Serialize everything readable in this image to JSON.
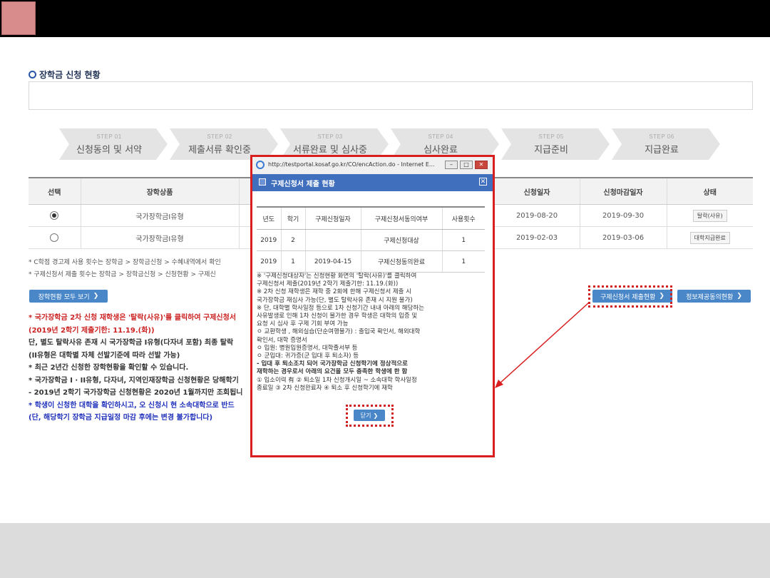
{
  "section_title": "장학금 신청 현황",
  "steps": [
    {
      "num": "STEP 01",
      "label": "신청동의 및 서약"
    },
    {
      "num": "STEP 02",
      "label": "제출서류 확인중"
    },
    {
      "num": "STEP 03",
      "label": "서류완료 및 심사중"
    },
    {
      "num": "STEP 04",
      "label": "심사완료"
    },
    {
      "num": "STEP 05",
      "label": "지급준비"
    },
    {
      "num": "STEP 06",
      "label": "지급완료"
    }
  ],
  "table": {
    "headers": [
      "선택",
      "장학상품",
      "신청일자",
      "신청마감일자",
      "상태"
    ],
    "rows": [
      {
        "product": "국가장학금I유형",
        "applied": "2019-08-20",
        "deadline": "2019-09-30",
        "status": "탈락(사유)",
        "selected": true
      },
      {
        "product": "국가장학금I유형",
        "applied": "2019-02-03",
        "deadline": "2019-03-06",
        "status": "대학지급완료",
        "selected": false
      }
    ]
  },
  "notes": [
    "* C학점 경고제 사용 횟수는 장학금 > 장학금신청 > 수혜내역에서 확인",
    "* 구제신청서 제출 횟수는 장학금 > 장학금신청 > 신청현황 > 구제신"
  ],
  "buttons": {
    "view_all": "장학현황 모두 보기",
    "relief_status": "구제신청서 제출현황",
    "info_share": "정보제공동의현황"
  },
  "bullets": [
    "* 국가장학금 2차 신청 재학생은 '탈락(사유)'를 클릭하여 구제신청서",
    "(2019년 2학기 제출기한: 11.19.(화))",
    "단, 별도 탈락사유 존재 시 국가장학금 I유형(다자녀 포함) 최종 탈락",
    "(II유형은 대학별 자체 선발기준에 따라 선발 가능)",
    "* 최근 2년간 신청한 장학현황을 확인할 수 있습니다.",
    "* 국가장학금 I · II유형, 다자녀, 지역인재장학금 신청현황은 당해학기",
    "- 2019년 2학기 국가장학금 신청현황은 2020년 1월까지만 조회됩니",
    "* 학생이 신청한 대학을 확인하시고, 오 신청시 현 소속대학으로 반드",
    "(단, 해당학기 장학금 지급일정 마감 후에는 변경 불가합니다)"
  ],
  "popup": {
    "url": "http://testportal.kosaf.go.kr/CO/encAction.do - Internet E...",
    "title": "구제신청서 제출 현황",
    "table": {
      "headers": [
        "년도",
        "학기",
        "구제신청일자",
        "구제신청서동의여부",
        "사용횟수"
      ],
      "rows": [
        [
          "2019",
          "2",
          "",
          "구제신청대상",
          "1"
        ],
        [
          "2019",
          "1",
          "2019-04-15",
          "구제신청동의완료",
          "1"
        ]
      ]
    },
    "notes": [
      "※ '구제신청대상자'는 신청현황 화면의 '탈락(사유)'를 클릭하여",
      "   구제신청서 제출(2019년 2학기 제출기한: 11.19.(화))",
      "※ 2차 신청 재학생은 재학 중 2회에 한해 구제신청서 제출 시",
      "   국가장학금 재심사 가능(단, 별도 탈락사유 존재 시 지원 불가)",
      "※ 단, 대학별 학사일정 등으로 1차 신청기간 내내 아래의 해당하는",
      "   사유발생로 인해 1차 신청이 불가한 경우 학생은 대학의 입증 및",
      "   요청 시 심사 후 구제 기회 부여 가능",
      "  ㅇ 교환학생 , 해외실습(단순여행불가) : 출입국 확인서, 해외대학",
      "     확인서, 대학 증명서",
      "  ㅇ 입원: 병원입원증명서, 대학졸서부 등",
      "  ㅇ 군입대: 귀가증(군 입대 후 퇴소자) 등",
      "   - 입대 후 퇴소조치 되어 국가장학금 신청학기에 정상적으로",
      "     재학하는 경우로서 아래의 요건을 모두 충족한 학생에 한 함",
      "     ① 입소이력 有 ② 퇴소일 1차 신청개시일 ~ 소속대학 학사일정",
      "     종료일 ③ 2차 신청완료자 ④ 퇴소 후 신청학기에 재학"
    ],
    "close_label": "닫기"
  },
  "colors": {
    "highlight_red": "#d12020",
    "button_blue": "#4a87c8",
    "popup_header": "#3f6fbd"
  }
}
